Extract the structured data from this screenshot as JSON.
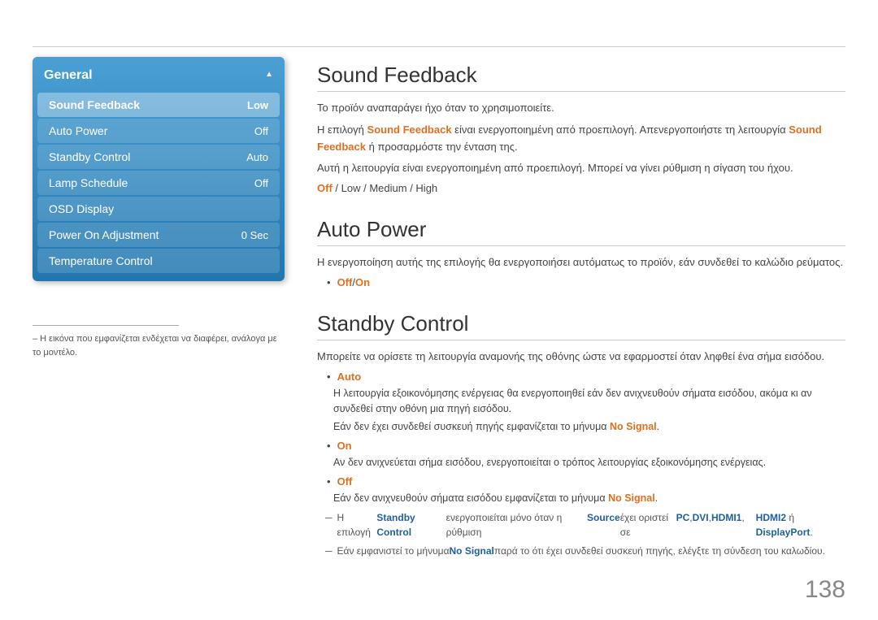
{
  "topLine": {},
  "sidebar": {
    "title": "General",
    "items": [
      {
        "label": "Sound Feedback",
        "value": "Low",
        "active": true
      },
      {
        "label": "Auto Power",
        "value": "Off",
        "active": false
      },
      {
        "label": "Standby Control",
        "value": "Auto",
        "active": false
      },
      {
        "label": "Lamp Schedule",
        "value": "Off",
        "active": false
      },
      {
        "label": "OSD Display",
        "value": "",
        "active": false
      },
      {
        "label": "Power On Adjustment",
        "value": "0 Sec",
        "active": false
      },
      {
        "label": "Temperature Control",
        "value": "",
        "active": false
      }
    ]
  },
  "footnote": {
    "text": "– Η εικόνα που εμφανίζεται ενδέχεται να διαφέρει, ανάλογα με το μοντέλο."
  },
  "soundFeedback": {
    "title": "Sound Feedback",
    "para1": "Το προϊόν αναπαράγει ήχο όταν το χρησιμοποιείτε.",
    "para2_prefix": "Η επιλογή ",
    "para2_highlight1": "Sound Feedback",
    "para2_middle": " είναι ενεργοποιημένη από προεπιλογή. Απενεργοποιήστε τη λειτουργία ",
    "para2_highlight2": "Sound Feedback",
    "para2_suffix": " ή προσαρμόστε την ένταση της.",
    "para3": "Αυτή η λειτουργία είναι ενεργοποιημένη από προεπιλογή. Μπορεί να γίνει ρύθμιση η σίγαση του ήχου.",
    "options_off": "Off",
    "options_sep1": " / ",
    "options_low": "Low",
    "options_sep2": " / ",
    "options_medium": "Medium",
    "options_sep3": " / ",
    "options_high": "High"
  },
  "autoPower": {
    "title": "Auto Power",
    "para1": "Η ενεργοποίηση αυτής της επιλογής θα ενεργοποιήσει αυτόματως το προϊόν, εάν συνδεθεί το καλώδιο ρεύματος.",
    "option_off": "Off",
    "option_sep": " / ",
    "option_on": "On"
  },
  "standbyControl": {
    "title": "Standby Control",
    "para1": "Μπορείτε να ορίσετε τη λειτουργία αναμονής της οθόνης ώστε να εφαρμοστεί όταν ληφθεί ένα σήμα εισόδου.",
    "bullet1_label": "Auto",
    "bullet1_text": "Η λειτουργία εξοικονόμησης ενέργειας θα ενεργοποιηθεί εάν δεν ανιχνευθούν σήματα εισόδου, ακόμα κι αν συνδεθεί στην οθόνη μια πηγή εισόδου.",
    "bullet1_nosignal_prefix": "Εάν δεν έχει συνδεθεί συσκευή πηγής εμφανίζεται το μήνυμα ",
    "bullet1_nosignal": "No Signal",
    "bullet1_nosignal_suffix": ".",
    "bullet2_label": "On",
    "bullet2_text": "Αν δεν ανιχνεύεται σήμα εισόδου, ενεργοποιείται ο τρόπος λειτουργίας εξοικονόμησης ενέργειας.",
    "bullet3_label": "Off",
    "bullet3_text": "Εάν δεν ανιχνευθούν σήματα εισόδου εμφανίζεται το μήνυμα ",
    "bullet3_nosignal": "No Signal",
    "bullet3_nosignal_suffix": ".",
    "note1_prefix": "Η επιλογή ",
    "note1_highlight1": "Standby Control",
    "note1_middle1": " ενεργοποιείται μόνο όταν η ρύθμιση ",
    "note1_highlight2": "Source",
    "note1_middle2": " έχει οριστεί σε ",
    "note1_pc": "PC",
    "note1_sep1": ", ",
    "note1_dvi": "DVI",
    "note1_sep2": ", ",
    "note1_hdmi1": "HDMI1",
    "note1_sep3": ",",
    "note1_hdmi2": "HDMI2",
    "note1_or": " ή ",
    "note1_displayport": "DisplayPort",
    "note1_suffix": ".",
    "note2_prefix": "Εάν εμφανιστεί το μήνυμα ",
    "note2_nosignal": "No Signal",
    "note2_suffix": " παρά το ότι έχει συνδεθεί συσκευή πηγής, ελέγξτε τη σύνδεση του καλωδίου."
  },
  "pageNumber": "138"
}
